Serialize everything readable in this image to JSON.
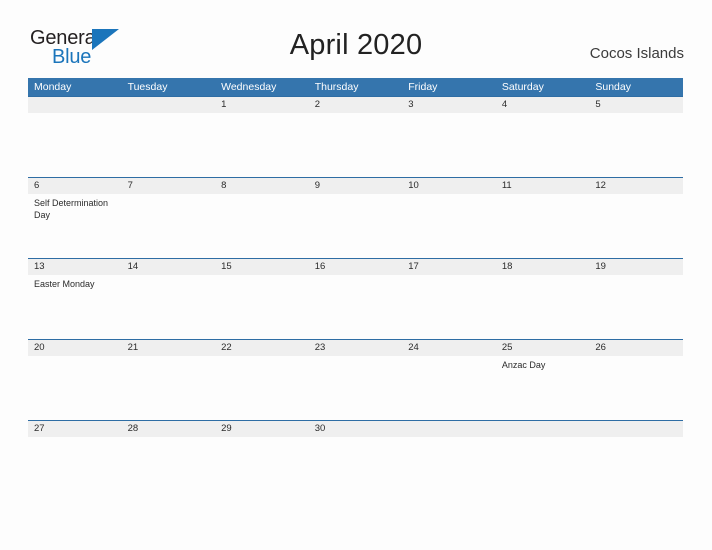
{
  "logo": {
    "word_top": "General",
    "word_bottom": "Blue",
    "triangle_icon": "triangle-icon"
  },
  "header": {
    "title": "April 2020",
    "region": "Cocos Islands"
  },
  "colors": {
    "header_blue": "#3575ad",
    "rule_blue": "#2e6da4",
    "date_band_gray": "#efefef",
    "logo_blue": "#1b75bb",
    "page_background": "#fdfdfd",
    "text_dark": "#2b2b2b"
  },
  "calendar": {
    "weekdays": [
      "Monday",
      "Tuesday",
      "Wednesday",
      "Thursday",
      "Friday",
      "Saturday",
      "Sunday"
    ],
    "weeks": [
      {
        "days": [
          {
            "date": "",
            "event": ""
          },
          {
            "date": "",
            "event": ""
          },
          {
            "date": "1",
            "event": ""
          },
          {
            "date": "2",
            "event": ""
          },
          {
            "date": "3",
            "event": ""
          },
          {
            "date": "4",
            "event": ""
          },
          {
            "date": "5",
            "event": ""
          }
        ]
      },
      {
        "days": [
          {
            "date": "6",
            "event": "Self Determination Day"
          },
          {
            "date": "7",
            "event": ""
          },
          {
            "date": "8",
            "event": ""
          },
          {
            "date": "9",
            "event": ""
          },
          {
            "date": "10",
            "event": ""
          },
          {
            "date": "11",
            "event": ""
          },
          {
            "date": "12",
            "event": ""
          }
        ]
      },
      {
        "days": [
          {
            "date": "13",
            "event": "Easter Monday"
          },
          {
            "date": "14",
            "event": ""
          },
          {
            "date": "15",
            "event": ""
          },
          {
            "date": "16",
            "event": ""
          },
          {
            "date": "17",
            "event": ""
          },
          {
            "date": "18",
            "event": ""
          },
          {
            "date": "19",
            "event": ""
          }
        ]
      },
      {
        "days": [
          {
            "date": "20",
            "event": ""
          },
          {
            "date": "21",
            "event": ""
          },
          {
            "date": "22",
            "event": ""
          },
          {
            "date": "23",
            "event": ""
          },
          {
            "date": "24",
            "event": ""
          },
          {
            "date": "25",
            "event": "Anzac Day"
          },
          {
            "date": "26",
            "event": ""
          }
        ]
      },
      {
        "days": [
          {
            "date": "27",
            "event": ""
          },
          {
            "date": "28",
            "event": ""
          },
          {
            "date": "29",
            "event": ""
          },
          {
            "date": "30",
            "event": ""
          },
          {
            "date": "",
            "event": ""
          },
          {
            "date": "",
            "event": ""
          },
          {
            "date": "",
            "event": ""
          }
        ]
      }
    ]
  }
}
